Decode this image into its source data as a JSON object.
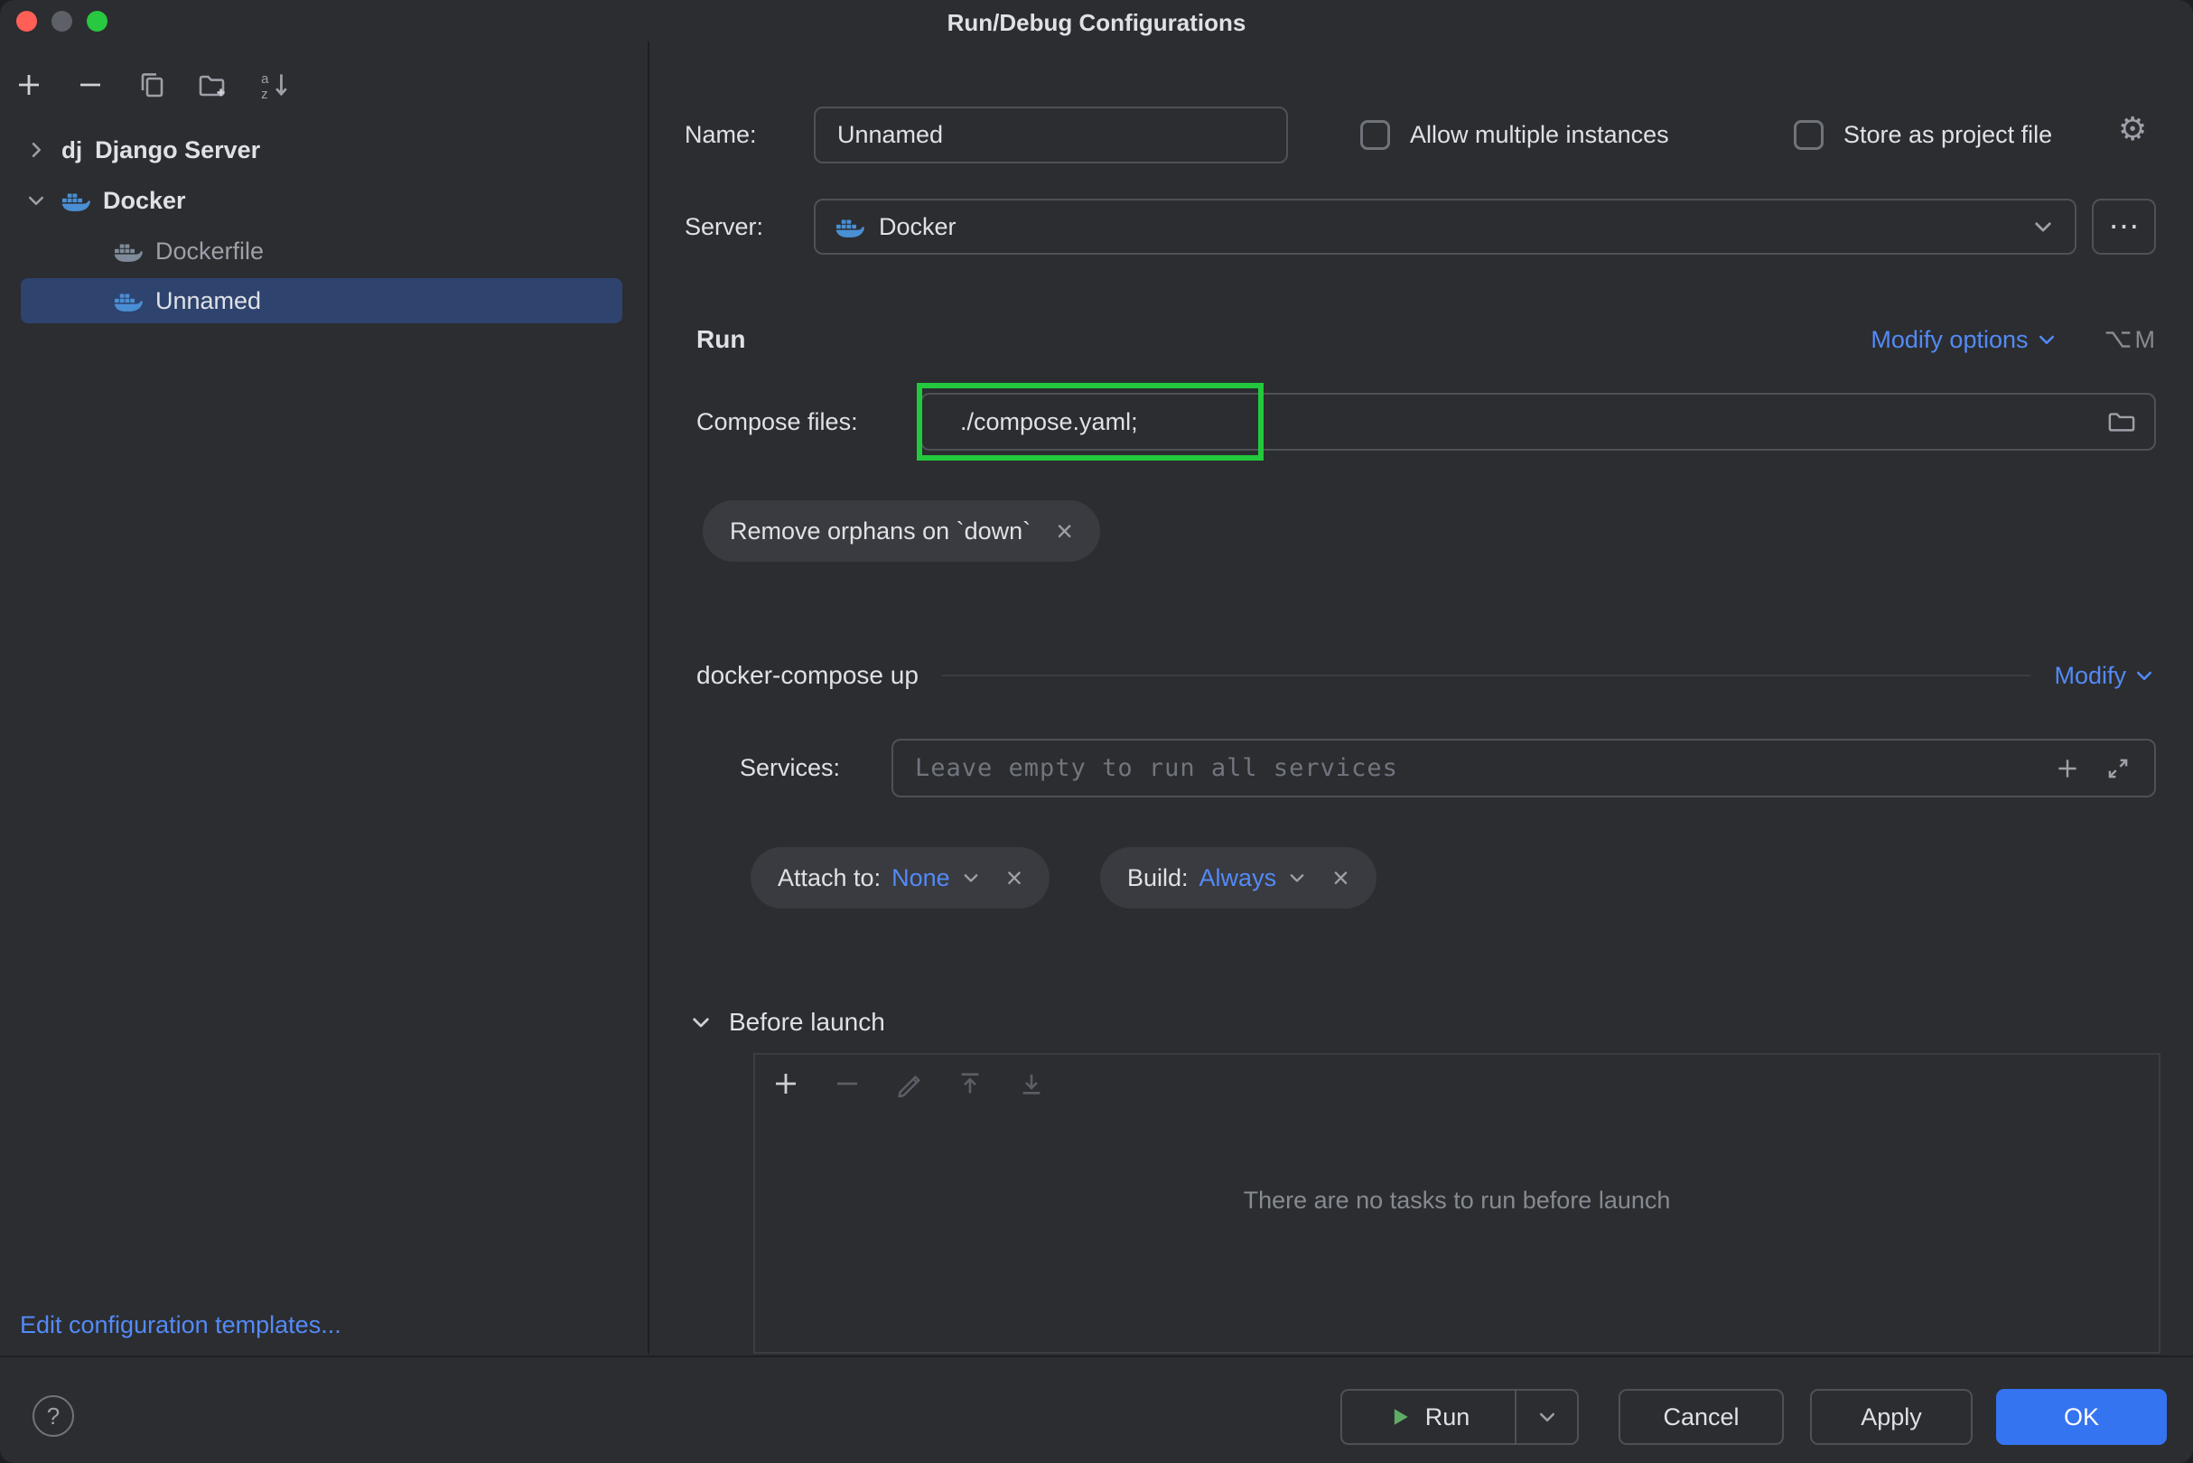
{
  "window": {
    "title": "Run/Debug Configurations"
  },
  "sidebar": {
    "tree": [
      {
        "badge": "dj",
        "label": "Django Server"
      },
      {
        "label": "Docker"
      },
      {
        "label": "Dockerfile"
      },
      {
        "label": "Unnamed"
      }
    ],
    "edit_templates_link": "Edit configuration templates..."
  },
  "form": {
    "name": {
      "label": "Name:",
      "value": "Unnamed"
    },
    "allow_multiple_label": "Allow multiple instances",
    "store_project_label": "Store as project file",
    "server": {
      "label": "Server:",
      "value": "Docker"
    },
    "run_section": {
      "title": "Run",
      "modify_options_label": "Modify options",
      "shortcut_key": "M"
    },
    "compose_files": {
      "label": "Compose files:",
      "value": "./compose.yaml;"
    },
    "remove_orphans_pill": "Remove orphans on `down`",
    "compose_up": {
      "title": "docker-compose up",
      "modify_label": "Modify"
    },
    "services": {
      "label": "Services:",
      "placeholder": "Leave empty to run all services"
    },
    "attach_pill": {
      "label": "Attach to:",
      "value": "None"
    },
    "build_pill": {
      "label": "Build:",
      "value": "Always"
    },
    "before_launch": {
      "title": "Before launch",
      "empty_text": "There are no tasks to run before launch"
    }
  },
  "footer": {
    "run_label": "Run",
    "cancel_label": "Cancel",
    "apply_label": "Apply",
    "ok_label": "OK"
  },
  "icons": {
    "more": "⋯",
    "gear": "⚙",
    "close": "×",
    "help": "?"
  },
  "colors": {
    "accent": "#3574f0",
    "link": "#548af7",
    "selection": "#2e436e",
    "highlight_green": "#22c93d"
  }
}
